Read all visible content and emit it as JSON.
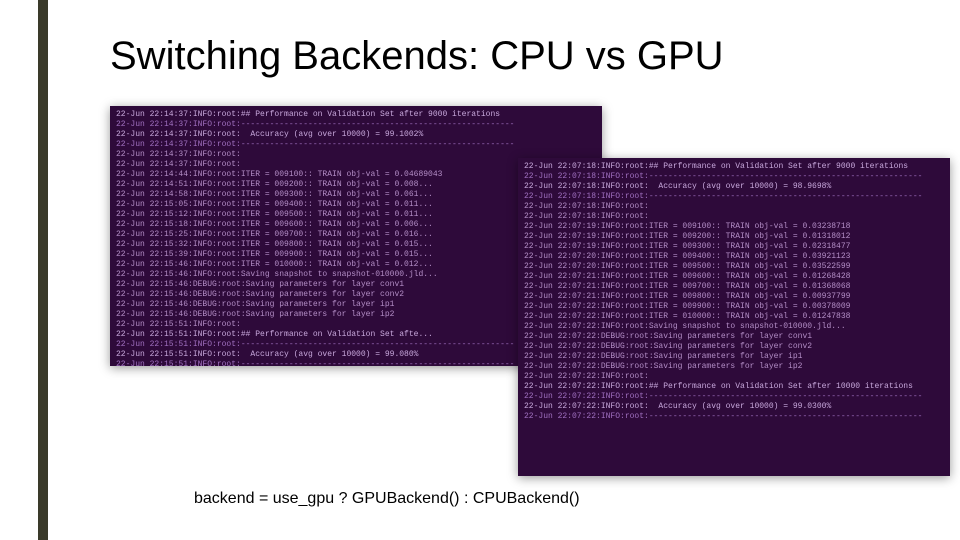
{
  "title": "Switching Backends: CPU vs GPU",
  "code_line": "backend = use_gpu ? GPUBackend() : CPUBackend()",
  "left_terminal": {
    "lines": [
      "22-Jun 22:14:37:INFO:root:## Performance on Validation Set after 9000 iterations",
      "22-Jun 22:14:37:INFO:root:---------------------------------------------------------",
      "22-Jun 22:14:37:INFO:root:  Accuracy (avg over 10000) = 99.1002%",
      "22-Jun 22:14:37:INFO:root:---------------------------------------------------------",
      "22-Jun 22:14:37:INFO:root:",
      "22-Jun 22:14:37:INFO:root:",
      "22-Jun 22:14:44:INFO:root:ITER = 009100:: TRAIN obj-val = 0.04689043",
      "22-Jun 22:14:51:INFO:root:ITER = 009200:: TRAIN obj-val = 0.008...",
      "22-Jun 22:14:58:INFO:root:ITER = 009300:: TRAIN obj-val = 0.061...",
      "22-Jun 22:15:05:INFO:root:ITER = 009400:: TRAIN obj-val = 0.011...",
      "22-Jun 22:15:12:INFO:root:ITER = 009500:: TRAIN obj-val = 0.011...",
      "22-Jun 22:15:18:INFO:root:ITER = 009600:: TRAIN obj-val = 0.006...",
      "22-Jun 22:15:25:INFO:root:ITER = 009700:: TRAIN obj-val = 0.016...",
      "22-Jun 22:15:32:INFO:root:ITER = 009800:: TRAIN obj-val = 0.015...",
      "22-Jun 22:15:39:INFO:root:ITER = 009900:: TRAIN obj-val = 0.015...",
      "22-Jun 22:15:46:INFO:root:ITER = 010000:: TRAIN obj-val = 0.012...",
      "22-Jun 22:15:46:INFO:root:Saving snapshot to snapshot-010000.jld...",
      "22-Jun 22:15:46:DEBUG:root:Saving parameters for layer conv1",
      "22-Jun 22:15:46:DEBUG:root:Saving parameters for layer conv2",
      "22-Jun 22:15:46:DEBUG:root:Saving parameters for layer ip1",
      "22-Jun 22:15:46:DEBUG:root:Saving parameters for layer ip2",
      "22-Jun 22:15:51:INFO:root:",
      "22-Jun 22:15:51:INFO:root:## Performance on Validation Set afte...",
      "22-Jun 22:15:51:INFO:root:---------------------------------------------------------",
      "22-Jun 22:15:51:INFO:root:  Accuracy (avg over 10000) = 99.080%",
      "22-Jun 22:15:51:INFO:root:---------------------------------------------------------"
    ]
  },
  "right_terminal": {
    "lines": [
      "22-Jun 22:07:18:INFO:root:## Performance on Validation Set after 9000 iterations",
      "22-Jun 22:07:18:INFO:root:---------------------------------------------------------",
      "22-Jun 22:07:18:INFO:root:  Accuracy (avg over 10000) = 98.9698%",
      "22-Jun 22:07:18:INFO:root:---------------------------------------------------------",
      "22-Jun 22:07:18:INFO:root:",
      "22-Jun 22:07:18:INFO:root:",
      "22-Jun 22:07:19:INFO:root:ITER = 009100:: TRAIN obj-val = 0.03238718",
      "22-Jun 22:07:19:INFO:root:ITER = 009200:: TRAIN obj-val = 0.01318012",
      "22-Jun 22:07:19:INFO:root:ITER = 009300:: TRAIN obj-val = 0.02318477",
      "22-Jun 22:07:20:INFO:root:ITER = 009400:: TRAIN obj-val = 0.03921123",
      "22-Jun 22:07:20:INFO:root:ITER = 009500:: TRAIN obj-val = 0.03522599",
      "22-Jun 22:07:21:INFO:root:ITER = 009600:: TRAIN obj-val = 0.01268428",
      "22-Jun 22:07:21:INFO:root:ITER = 009700:: TRAIN obj-val = 0.01368068",
      "22-Jun 22:07:21:INFO:root:ITER = 009800:: TRAIN obj-val = 0.00937799",
      "22-Jun 22:07:22:INFO:root:ITER = 009900:: TRAIN obj-val = 0.00378009",
      "22-Jun 22:07:22:INFO:root:ITER = 010000:: TRAIN obj-val = 0.01247838",
      "22-Jun 22:07:22:INFO:root:Saving snapshot to snapshot-010000.jld...",
      "22-Jun 22:07:22:DEBUG:root:Saving parameters for layer conv1",
      "22-Jun 22:07:22:DEBUG:root:Saving parameters for layer conv2",
      "22-Jun 22:07:22:DEBUG:root:Saving parameters for layer ip1",
      "22-Jun 22:07:22:DEBUG:root:Saving parameters for layer ip2",
      "22-Jun 22:07:22:INFO:root:",
      "22-Jun 22:07:22:INFO:root:## Performance on Validation Set after 10000 iterations",
      "22-Jun 22:07:22:INFO:root:---------------------------------------------------------",
      "22-Jun 22:07:22:INFO:root:  Accuracy (avg over 10000) = 99.0300%",
      "22-Jun 22:07:22:INFO:root:---------------------------------------------------------"
    ]
  }
}
